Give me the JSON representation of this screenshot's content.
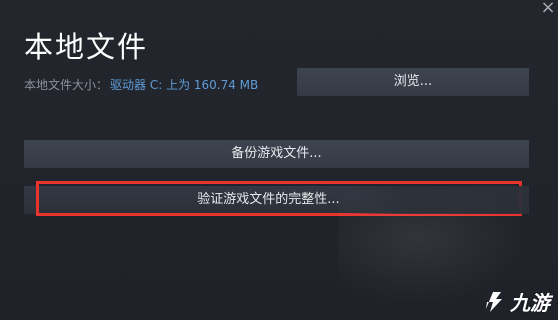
{
  "window": {
    "title": "本地文件",
    "close_glyph": "×"
  },
  "local_files": {
    "size_label": "本地文件大小：",
    "drive_info": "驱动器 C: 上为 160.74 MB"
  },
  "buttons": {
    "browse": "浏览...",
    "backup": "备份游戏文件...",
    "verify": "验证游戏文件的完整性..."
  },
  "watermark": {
    "logo_text": "九游",
    "logo_icon": "jiuyou-logo-icon"
  },
  "colors": {
    "background": "#1f2228",
    "button": "#3d4450",
    "link_blue": "#5f9bd6",
    "highlight_red": "#e8332f"
  }
}
